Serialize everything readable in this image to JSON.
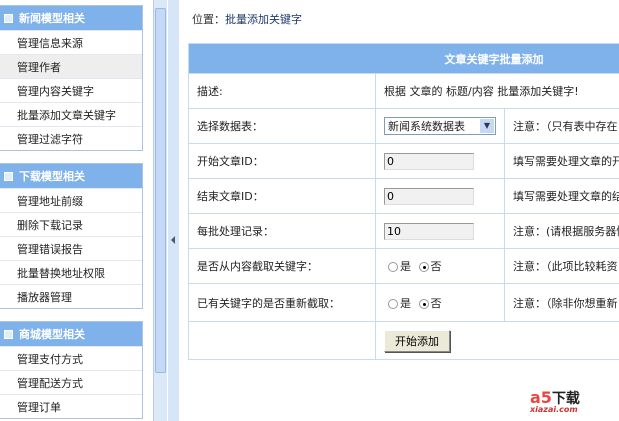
{
  "sidebar": {
    "sections": [
      {
        "title": "新闻模型相关",
        "items": [
          "管理信息来源",
          "管理作者",
          "管理内容关键字",
          "批量添加文章关键字",
          "管理过滤字符"
        ]
      },
      {
        "title": "下载模型相关",
        "items": [
          "管理地址前缀",
          "删除下载记录",
          "管理错误报告",
          "批量替换地址权限",
          "播放器管理"
        ]
      },
      {
        "title": "商城模型相关",
        "items": [
          "管理支付方式",
          "管理配送方式",
          "管理订单"
        ]
      }
    ]
  },
  "breadcrumb": {
    "label": "位置：",
    "current": "批量添加关键字"
  },
  "form": {
    "title": "文章关键字批量添加",
    "desc_label": "描述:",
    "desc_value": "根据 文章的 标题/内容 批量添加关键字!",
    "table_label": "选择数据表：",
    "table_value": "新闻系统数据表",
    "table_note": "注意：（只有表中存在",
    "start_label": "开始文章ID：",
    "start_value": "0",
    "start_note": "填写需要处理文章的开",
    "end_label": "结束文章ID：",
    "end_value": "0",
    "end_note": "填写需要处理文章的结",
    "batch_label": "每批处理记录：",
    "batch_value": "10",
    "batch_note": "注意：(请根据服务器情",
    "content_label": "是否从内容截取关键字：",
    "content_note": "注意：（此项比较耗资",
    "redo_label": "已有关键字的是否重新截取：",
    "redo_note": "注意：（除非你想重新",
    "yes": "是",
    "no": "否",
    "submit": "开始添加"
  },
  "logo": {
    "brand": "a5",
    "text": "下载",
    "url": "xiazai.com"
  }
}
